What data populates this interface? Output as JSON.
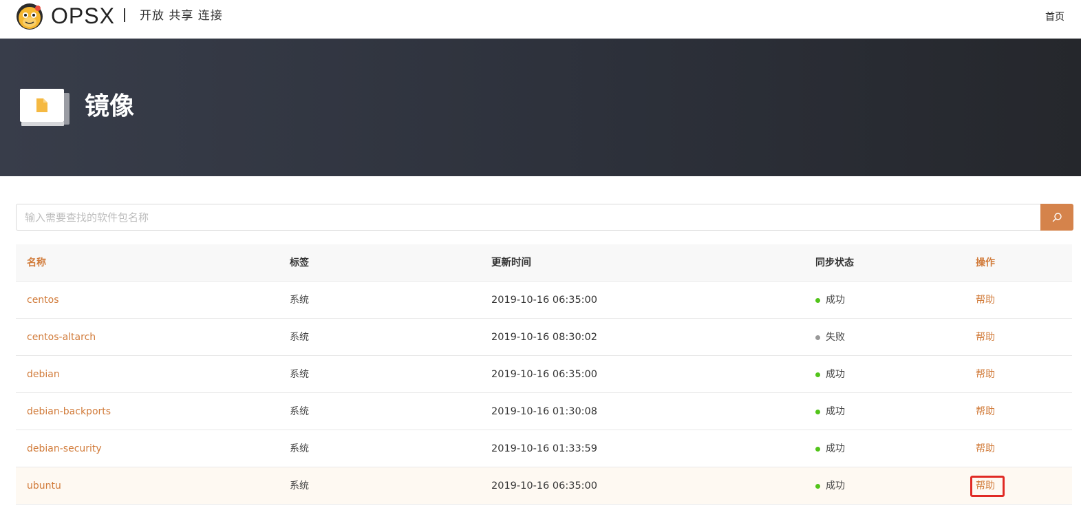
{
  "header": {
    "brand": "OPSX",
    "slogan": "开放 共享 连接",
    "nav_home": "首页"
  },
  "banner": {
    "title": "镜像"
  },
  "search": {
    "placeholder": "输入需要查找的软件包名称",
    "button_icon": "search-icon"
  },
  "table": {
    "columns": [
      "名称",
      "标签",
      "更新时间",
      "同步状态",
      "操作"
    ],
    "rows": [
      {
        "name": "centos",
        "tag": "系统",
        "time": "2019-10-16 06:35:00",
        "status": "成功",
        "status_color": "#52c41a",
        "op": "帮助"
      },
      {
        "name": "centos-altarch",
        "tag": "系统",
        "time": "2019-10-16 08:30:02",
        "status": "失败",
        "status_color": "#999999",
        "op": "帮助"
      },
      {
        "name": "debian",
        "tag": "系统",
        "time": "2019-10-16 06:35:00",
        "status": "成功",
        "status_color": "#52c41a",
        "op": "帮助"
      },
      {
        "name": "debian-backports",
        "tag": "系统",
        "time": "2019-10-16 01:30:08",
        "status": "成功",
        "status_color": "#52c41a",
        "op": "帮助"
      },
      {
        "name": "debian-security",
        "tag": "系统",
        "time": "2019-10-16 01:33:59",
        "status": "成功",
        "status_color": "#52c41a",
        "op": "帮助"
      },
      {
        "name": "ubuntu",
        "tag": "系统",
        "time": "2019-10-16 06:35:00",
        "status": "成功",
        "status_color": "#52c41a",
        "op": "帮助"
      }
    ]
  },
  "colors": {
    "accent": "#d5834b",
    "link": "#d17b3a",
    "highlight_box": "#e02a25"
  }
}
